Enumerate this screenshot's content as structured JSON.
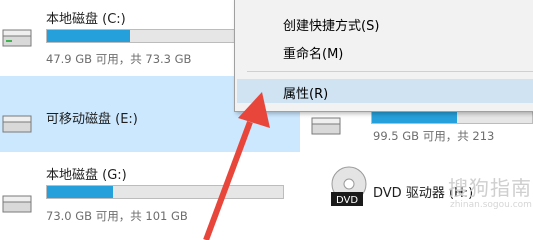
{
  "drives": [
    {
      "name": "本地磁盘 (C:)",
      "space_text": "47.9 GB 可用，共 73.3 GB",
      "used_fraction": 0.35
    },
    {
      "name": "可移动磁盘 (E:)",
      "selected": true
    },
    {
      "name": "本地磁盘 (G:)",
      "space_text": "73.0 GB 可用，共 101 GB",
      "used_fraction": 0.28
    },
    {
      "space_text": "99.5 GB 可用，共 213",
      "used_fraction": 0.53
    },
    {
      "name": "DVD 驱动器 (H:)",
      "disc_label": "DVD"
    }
  ],
  "context_menu": {
    "items": [
      {
        "label": "创建快捷方式(S)"
      },
      {
        "label": "重命名(M)"
      },
      {
        "label": "属性(R)",
        "highlighted": true
      }
    ]
  },
  "watermark": {
    "text": "搜狗指南",
    "sub": "zhinan.sogou.com"
  },
  "colors": {
    "bar_fill": "#26a0da",
    "selection": "#cce8ff",
    "arrow": "#e8463b"
  }
}
